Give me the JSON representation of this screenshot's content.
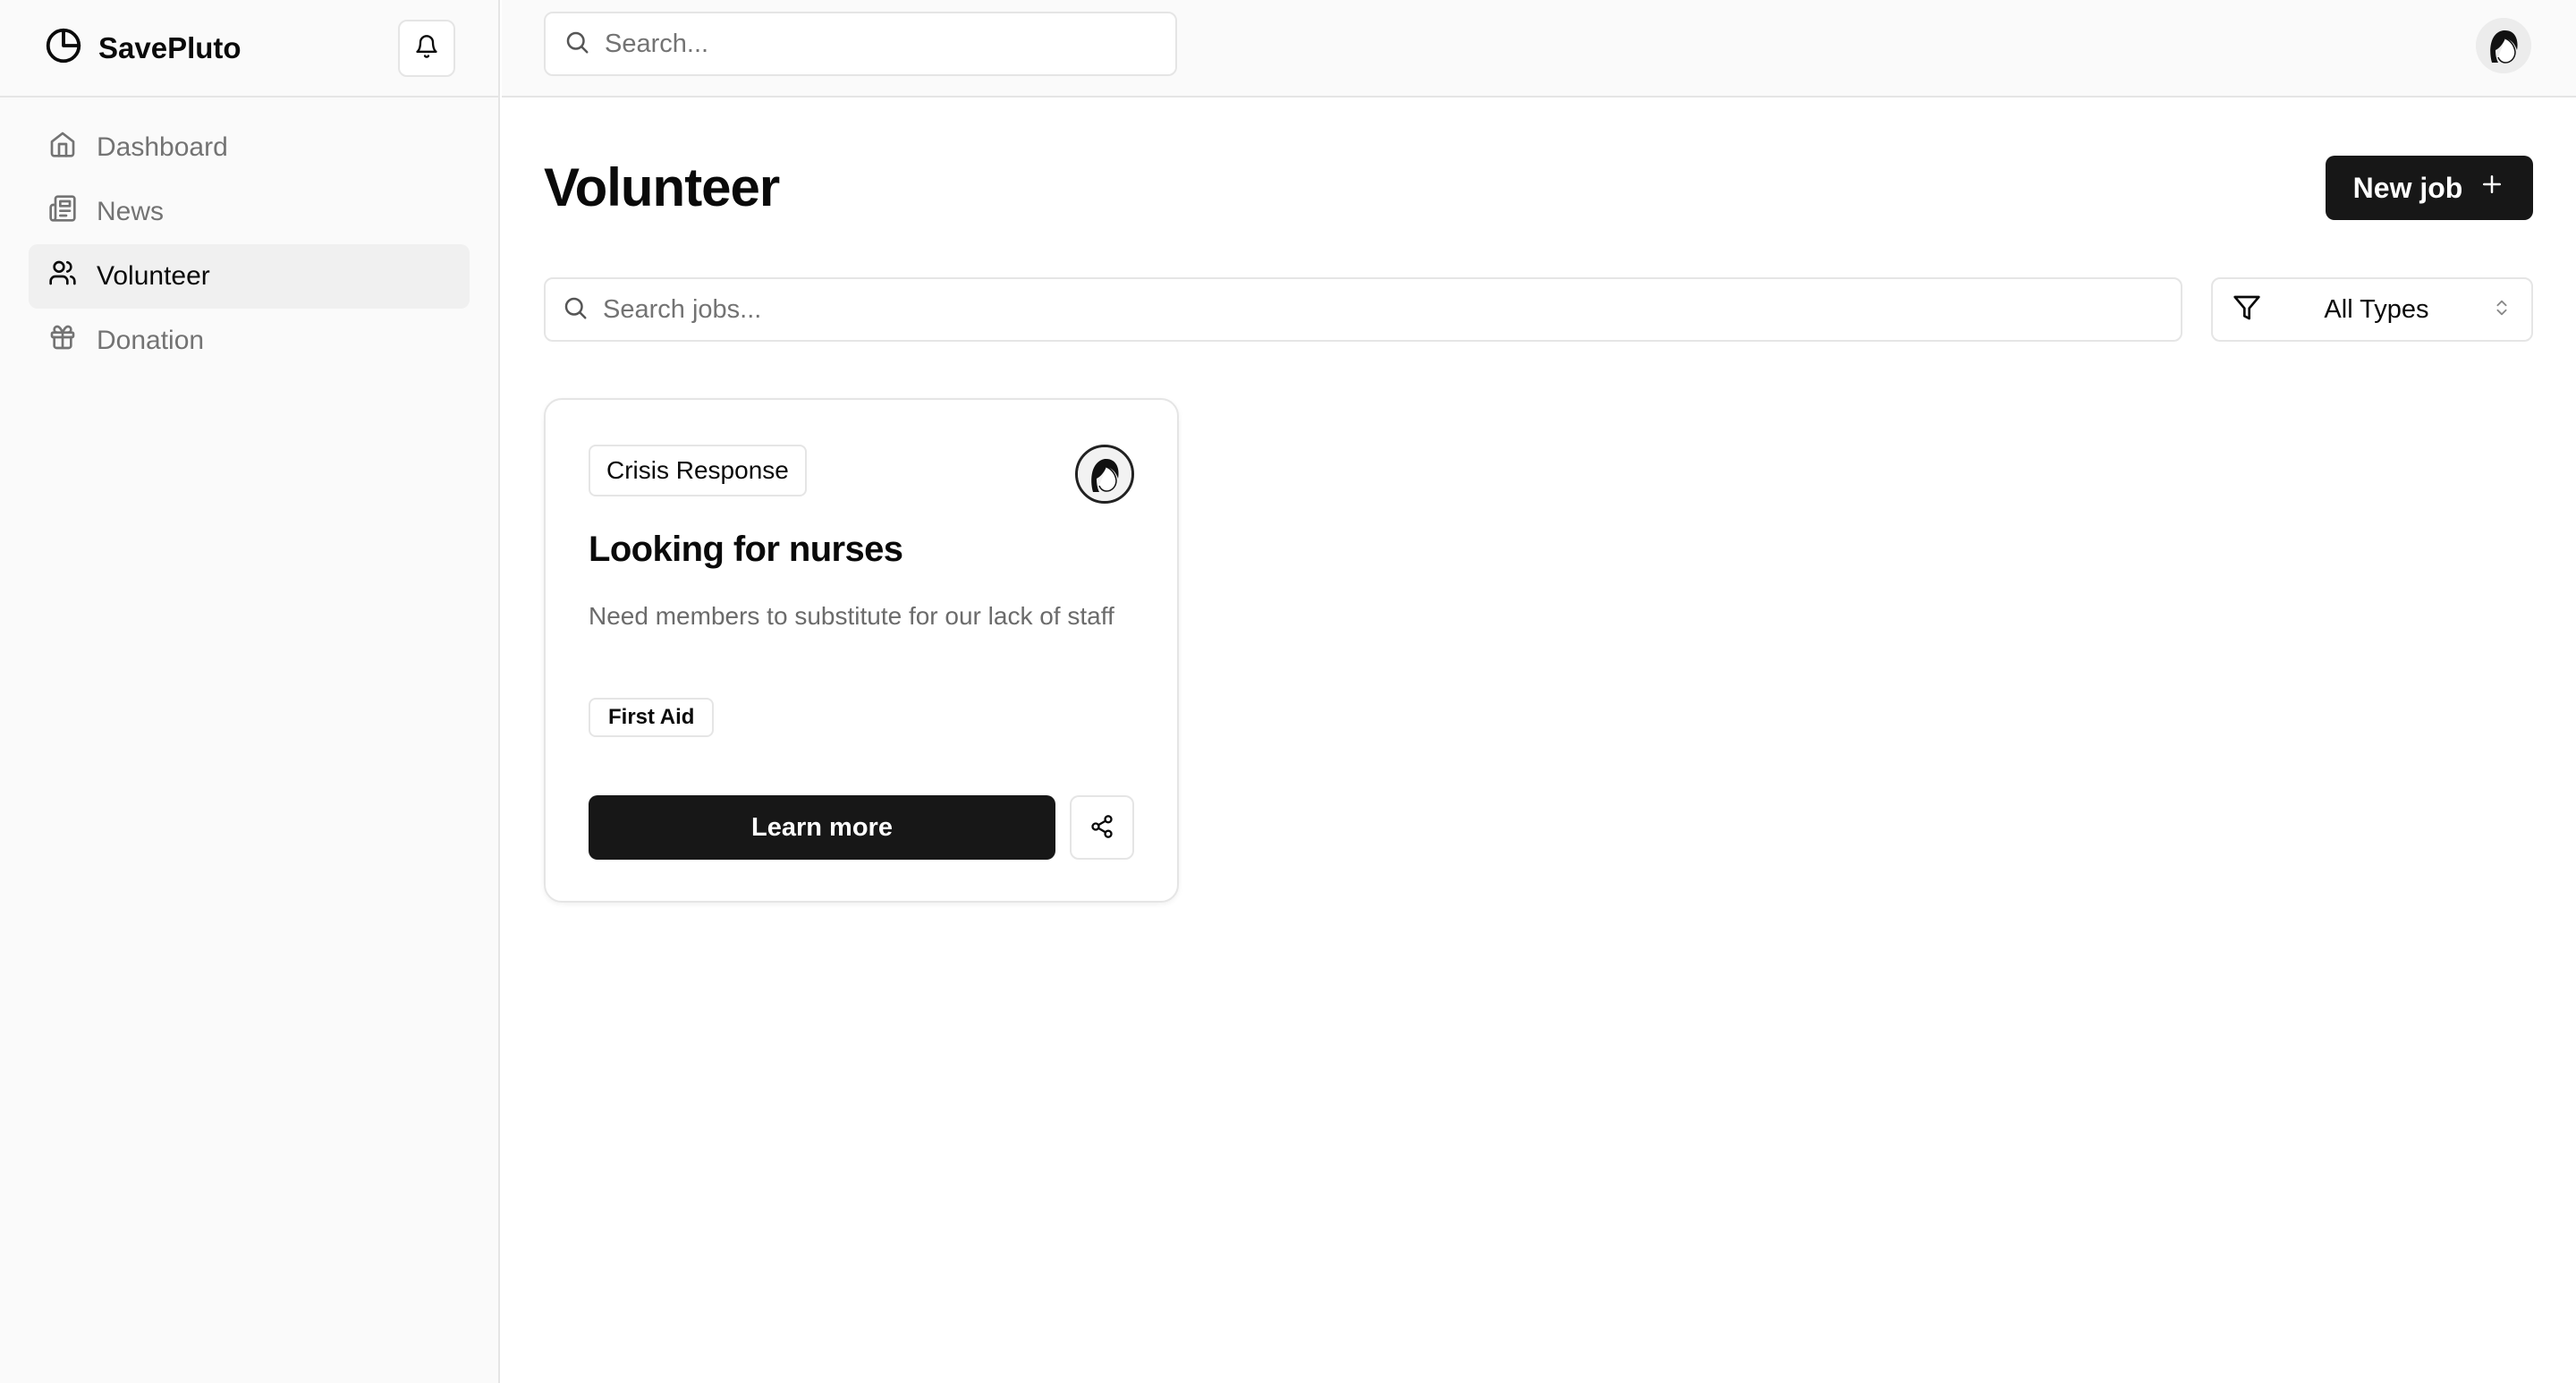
{
  "app": {
    "name": "SavePluto"
  },
  "sidebar": {
    "items": [
      {
        "label": "Dashboard",
        "icon": "home-icon",
        "active": false
      },
      {
        "label": "News",
        "icon": "newspaper-icon",
        "active": false
      },
      {
        "label": "Volunteer",
        "icon": "users-icon",
        "active": true
      },
      {
        "label": "Donation",
        "icon": "gift-icon",
        "active": false
      }
    ]
  },
  "topbar": {
    "search_placeholder": "Search..."
  },
  "main": {
    "title": "Volunteer",
    "new_job_label": "New job",
    "jobs_search_placeholder": "Search jobs...",
    "type_filter": {
      "selected": "All Types"
    }
  },
  "jobs": [
    {
      "category": "Crisis Response",
      "title": "Looking for nurses",
      "description": "Need members to substitute for our lack of staff",
      "tags": [
        "First Aid"
      ],
      "action_label": "Learn more"
    }
  ],
  "colors": {
    "primary": "#171717",
    "sidebar_bg": "#fafafa",
    "border": "#e5e5e5",
    "muted_text": "#737373"
  }
}
